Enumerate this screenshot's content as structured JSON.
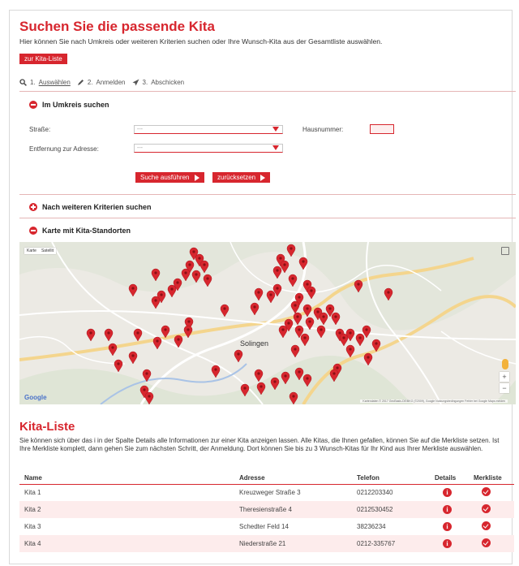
{
  "header": {
    "title": "Suchen Sie die passende Kita",
    "intro": "Hier können Sie nach Umkreis oder weiteren Kriterien suchen oder Ihre Wunsch-Kita aus der Gesamtliste auswählen.",
    "list_button": "zur Kita-Liste"
  },
  "steps": [
    {
      "label": "1.",
      "link": "Auswählen"
    },
    {
      "label": "2.",
      "link": "Anmelden"
    },
    {
      "label": "3.",
      "link": "Abschicken"
    }
  ],
  "umkreis": {
    "heading": "Im Umkreis suchen",
    "street_label": "Straße:",
    "street_value": "---",
    "house_label": "Hausnummer:",
    "distance_label": "Entfernung zur Adresse:",
    "distance_value": "---",
    "search_button": "Suche ausführen",
    "reset_button": "zurücksetzen"
  },
  "kriterien": {
    "heading": "Nach weiteren Kriterien suchen"
  },
  "karte": {
    "heading": "Karte mit Kita-Standorten",
    "toggle_map": "Karte",
    "toggle_sat": "Satellit",
    "city": "Solingen",
    "google": "Google",
    "attribution": "Kartendaten © 2017 GeoBasis-DE/BKG (©2009), Google   Nutzungsbedingungen   Fehler bei Google Maps melden",
    "zoom_in": "+",
    "zoom_out": "−",
    "accent": "#d7262e"
  },
  "kita_liste": {
    "heading": "Kita-Liste",
    "text": "Sie können sich über das i in der Spalte Details alle Informationen zur einer Kita anzeigen lassen. Alle Kitas, die Ihnen gefallen, können Sie auf die Merkliste setzen. Ist Ihre Merkliste komplett, dann gehen Sie zum nächsten Schritt, der Anmeldung. Dort können Sie bis zu 3 Wunsch-Kitas für Ihr Kind aus Ihrer Merkliste auswählen.",
    "columns": [
      "Name",
      "Adresse",
      "Telefon",
      "Details",
      "Merkliste"
    ],
    "rows": [
      {
        "name": "Kita 1",
        "adresse": "Kreuzweger Straße 3",
        "telefon": "0212203340"
      },
      {
        "name": "Kita 2",
        "adresse": "Theresienstraße 4",
        "telefon": "0212530452"
      },
      {
        "name": "Kita 3",
        "adresse": "Schedter Feld 14",
        "telefon": "38236234"
      },
      {
        "name": "Kita 4",
        "adresse": "Niederstraße 21",
        "telefon": "0212-335767"
      }
    ]
  }
}
